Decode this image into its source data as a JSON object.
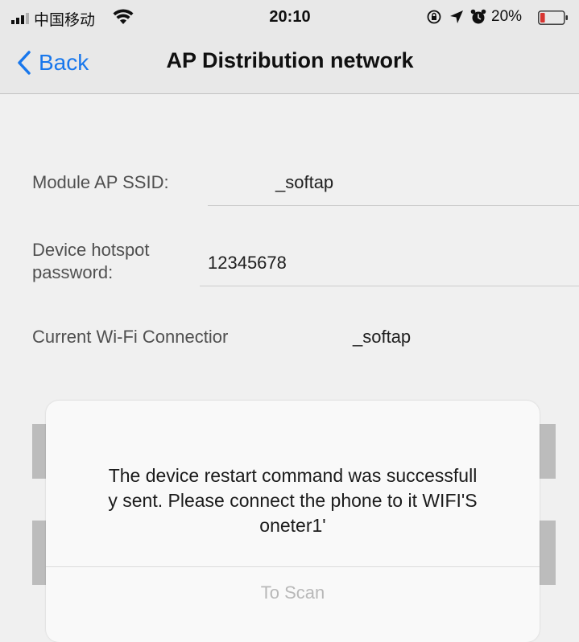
{
  "status_bar": {
    "carrier": "中国移动",
    "time": "20:10",
    "battery_percent": "20%",
    "icons": [
      "signal-icon",
      "wifi-icon",
      "orientation-lock-icon",
      "location-icon",
      "alarm-icon",
      "battery-icon"
    ],
    "battery_level": 0.2,
    "battery_color": "#e53935"
  },
  "nav": {
    "back_label": "Back",
    "title": "AP Distribution network",
    "accent_color": "#1a7ffb"
  },
  "form": {
    "module_ssid_label": "Module AP SSID:",
    "module_ssid_value": "_softap",
    "hotspot_password_label": "Device hotspot\npassword:",
    "hotspot_password_value": "12345678",
    "current_wifi_label": "Current Wi-Fi Connectior",
    "current_wifi_value": "_softap"
  },
  "alert": {
    "message": "The device restart command was successfull\ny sent. Please connect the phone to it WIFI'S\noneter1'",
    "action_label": "To Scan"
  }
}
